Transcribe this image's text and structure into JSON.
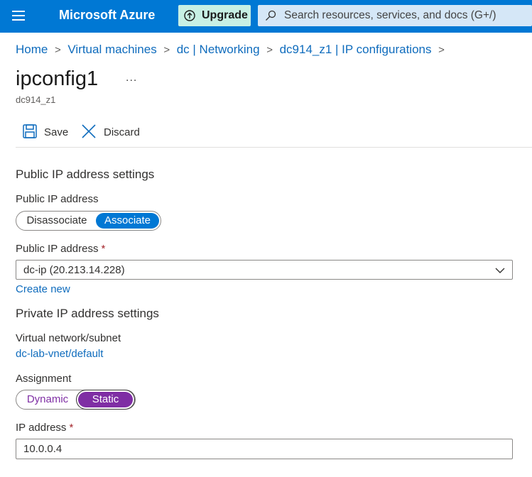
{
  "topbar": {
    "brand": "Microsoft Azure",
    "upgrade_label": "Upgrade",
    "search_placeholder": "Search resources, services, and docs (G+/)",
    "accent": "#0078d4"
  },
  "breadcrumb": [
    "Home",
    "Virtual machines",
    "dc | Networking",
    "dc914_z1 | IP configurations"
  ],
  "page": {
    "title": "ipconfig1",
    "more": "...",
    "subtitle": "dc914_z1"
  },
  "toolbar": {
    "save_label": "Save",
    "discard_label": "Discard",
    "save_icon": "save-icon",
    "discard_icon": "close-icon"
  },
  "public_ip": {
    "section_title": "Public IP address settings",
    "toggle_label": "Public IP address",
    "options": [
      "Disassociate",
      "Associate"
    ],
    "selected": "Associate",
    "selected_color": "#0078d4",
    "field_label": "Public IP address",
    "required": "*",
    "field_value": "dc-ip (20.213.14.228)",
    "create_new": "Create new"
  },
  "private_ip": {
    "section_title": "Private IP address settings",
    "vnet_label": "Virtual network/subnet",
    "vnet_value": "dc-lab-vnet/default",
    "assignment_label": "Assignment",
    "options": [
      "Dynamic",
      "Static"
    ],
    "selected": "Static",
    "selected_color": "#7f2ea4",
    "ip_label": "IP address",
    "required": "*",
    "ip_value": "10.0.0.4"
  }
}
